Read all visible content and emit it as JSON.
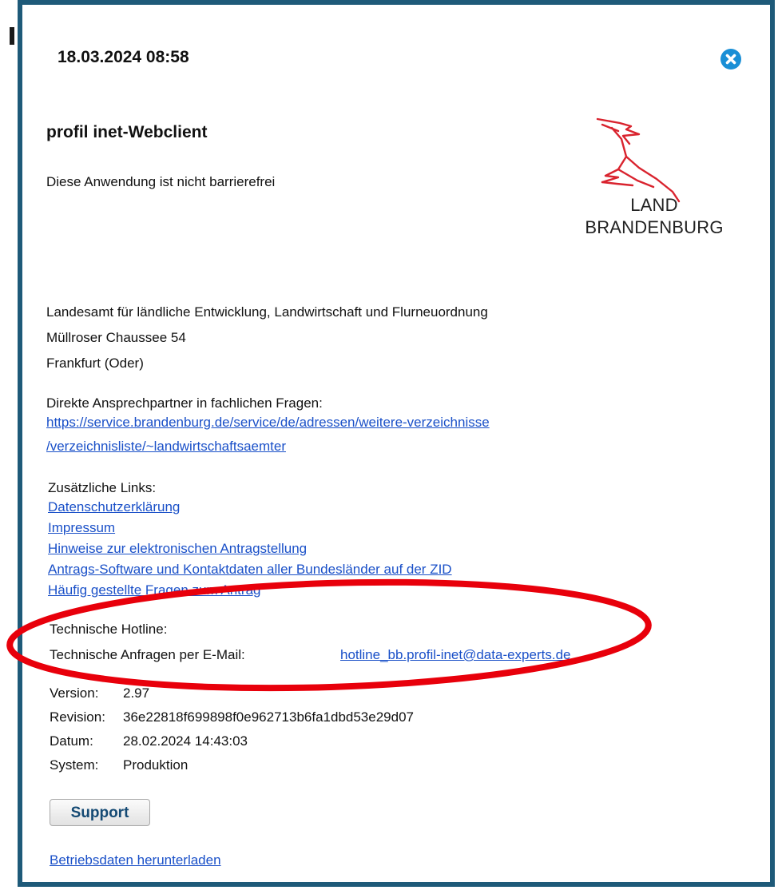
{
  "colors": {
    "frame_border": "#1e5a79",
    "close_button": "#1a8fd6",
    "link": "#1a50c8",
    "logo_eagle": "#d9232e",
    "annotation_ellipse": "#e8000b",
    "support_text": "#154a74"
  },
  "dialog": {
    "timestamp": "18.03.2024 08:58",
    "close_icon": "close-circle-icon",
    "app_title": "profil inet-Webclient",
    "accessibility_notice": "Diese Anwendung ist nicht barrierefrei"
  },
  "logo": {
    "icon": "eagle-icon",
    "line1": "LAND",
    "line2": "BRANDENBURG"
  },
  "address": {
    "org": "Landesamt für ländliche Entwicklung, Landwirtschaft und Flurneuordnung",
    "street": "Müllroser Chaussee 54",
    "city": "Frankfurt (Oder)"
  },
  "contacts": {
    "label": "Direkte Ansprechpartner in fachlichen Fragen:",
    "url_line1": "https://service.brandenburg.de/service/de/adressen/weitere-verzeichnisse",
    "url_line2": "/verzeichnisliste/~landwirtschaftsaemter"
  },
  "links": {
    "label": "Zusätzliche Links:",
    "items": [
      "Datenschutzerklärung",
      "Impressum",
      "Hinweise zur elektronischen Antragstellung",
      "Antrags-Software und Kontaktdaten aller Bundesländer auf der ZID",
      "Häufig gestellte Fragen zum Antrag"
    ]
  },
  "hotline": {
    "label": "Technische Hotline:",
    "email_label": "Technische Anfragen per E-Mail:",
    "email": "hotline_bb.profil-inet@data-experts.de"
  },
  "version_info": {
    "version_key": "Version:",
    "version_value": "2.97",
    "revision_key": "Revision:",
    "revision_value": "36e22818f699898f0e962713b6fa1dbd53e29d07",
    "date_key": "Datum:",
    "date_value": "28.02.2024 14:43:03",
    "system_key": "System:",
    "system_value": "Produktion"
  },
  "actions": {
    "support_label": "Support",
    "download_link": "Betriebsdaten herunterladen"
  }
}
